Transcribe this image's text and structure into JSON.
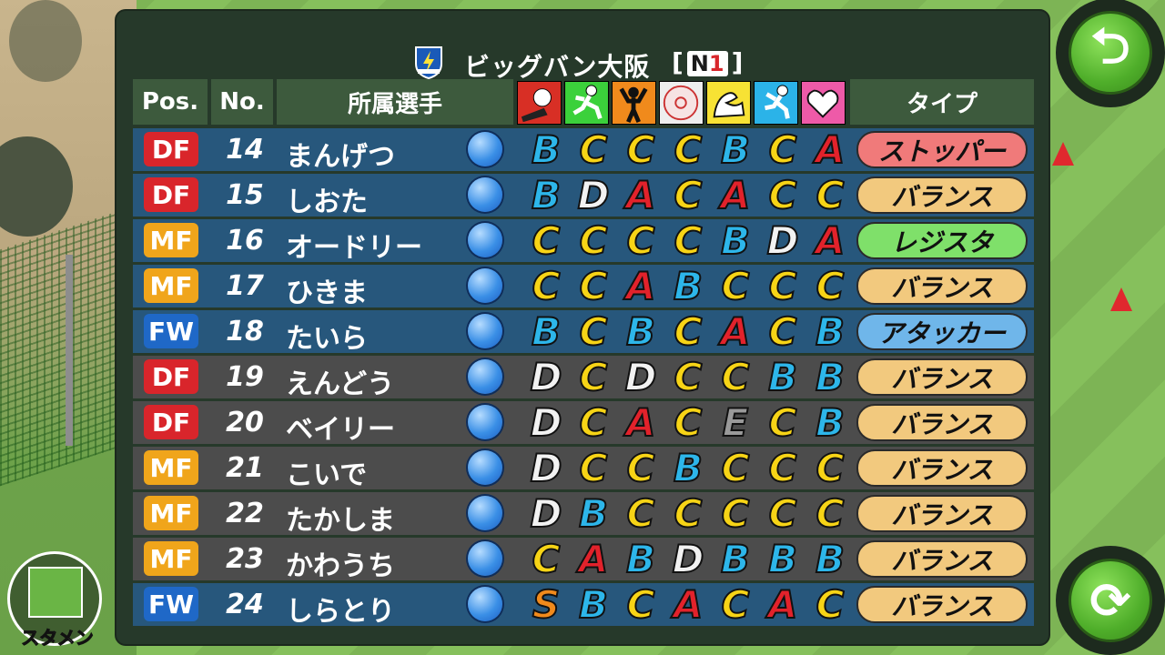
{
  "team": {
    "name": "ビッグバン大阪",
    "league_open": "[",
    "league_code": "N",
    "league_num": "1",
    "league_close": "]"
  },
  "headers": {
    "pos": "Pos.",
    "no": "No.",
    "player": "所属選手",
    "type": "タイプ"
  },
  "stat_icons": [
    "shoot-icon",
    "dribble-icon",
    "strength-icon",
    "ball-icon",
    "power-icon",
    "speed-icon",
    "heart-icon"
  ],
  "players": [
    {
      "pos": "DF",
      "no": "14",
      "name": "まんげつ",
      "grades": [
        "B",
        "C",
        "C",
        "C",
        "B",
        "C",
        "A"
      ],
      "type": "ストッパー"
    },
    {
      "pos": "DF",
      "no": "15",
      "name": "しおた",
      "grades": [
        "B",
        "D",
        "A",
        "C",
        "A",
        "C",
        "C"
      ],
      "type": "バランス"
    },
    {
      "pos": "MF",
      "no": "16",
      "name": "オードリー",
      "grades": [
        "C",
        "C",
        "C",
        "C",
        "B",
        "D",
        "A"
      ],
      "type": "レジスタ"
    },
    {
      "pos": "MF",
      "no": "17",
      "name": "ひきま",
      "grades": [
        "C",
        "C",
        "A",
        "B",
        "C",
        "C",
        "C"
      ],
      "type": "バランス"
    },
    {
      "pos": "FW",
      "no": "18",
      "name": "たいら",
      "grades": [
        "B",
        "C",
        "B",
        "C",
        "A",
        "C",
        "B"
      ],
      "type": "アタッカー"
    },
    {
      "pos": "DF",
      "no": "19",
      "name": "えんどう",
      "grades": [
        "D",
        "C",
        "D",
        "C",
        "C",
        "B",
        "B"
      ],
      "type": "バランス"
    },
    {
      "pos": "DF",
      "no": "20",
      "name": "ベイリー",
      "grades": [
        "D",
        "C",
        "A",
        "C",
        "E",
        "C",
        "B"
      ],
      "type": "バランス"
    },
    {
      "pos": "MF",
      "no": "21",
      "name": "こいで",
      "grades": [
        "D",
        "C",
        "C",
        "B",
        "C",
        "C",
        "C"
      ],
      "type": "バランス"
    },
    {
      "pos": "MF",
      "no": "22",
      "name": "たかしま",
      "grades": [
        "D",
        "B",
        "C",
        "C",
        "C",
        "C",
        "C"
      ],
      "type": "バランス"
    },
    {
      "pos": "MF",
      "no": "23",
      "name": "かわうち",
      "grades": [
        "C",
        "A",
        "B",
        "D",
        "B",
        "B",
        "B"
      ],
      "type": "バランス"
    },
    {
      "pos": "FW",
      "no": "24",
      "name": "しらとり",
      "grades": [
        "S",
        "B",
        "C",
        "A",
        "C",
        "A",
        "C"
      ],
      "type": "バランス"
    }
  ],
  "row_colors": [
    "blue",
    "blue",
    "blue",
    "blue",
    "blue",
    "gray",
    "gray",
    "gray",
    "gray",
    "gray",
    "blue"
  ],
  "type_colors": {
    "ストッパー": "#f07a7a",
    "バランス": "#f2c97e",
    "レジスタ": "#7fe06a",
    "アタッカー": "#6fb6ea"
  },
  "buttons": {
    "back": "⮌",
    "swap": "⟳",
    "starter_label": "スタメン"
  }
}
